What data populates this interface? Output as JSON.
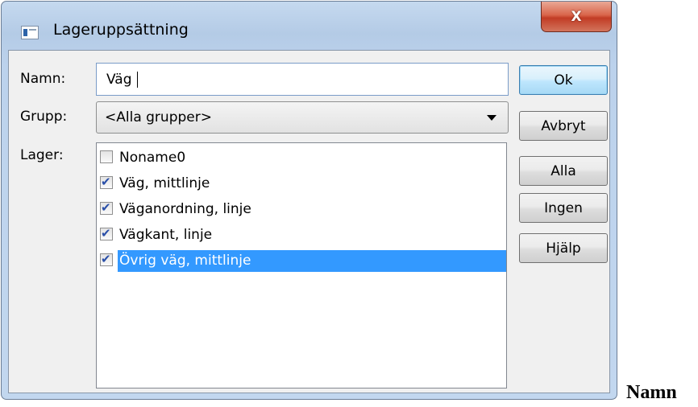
{
  "window": {
    "title": "Lageruppsättning",
    "close_glyph": "X"
  },
  "form": {
    "name_label": "Namn:",
    "name_value": "Väg",
    "group_label": "Grupp:",
    "group_value": "<Alla grupper>",
    "layers_label": "Lager:"
  },
  "layers": [
    {
      "label": "Noname0",
      "checked": false,
      "selected": false
    },
    {
      "label": "Väg, mittlinje",
      "checked": true,
      "selected": false
    },
    {
      "label": "Väganordning, linje",
      "checked": true,
      "selected": false
    },
    {
      "label": "Vägkant, linje",
      "checked": true,
      "selected": false
    },
    {
      "label": "Övrig väg, mittlinje",
      "checked": true,
      "selected": true
    }
  ],
  "buttons": {
    "ok": "Ok",
    "cancel": "Avbryt",
    "all": "Alla",
    "none": "Ingen",
    "help": "Hjälp"
  },
  "outside_text": "Namn"
}
